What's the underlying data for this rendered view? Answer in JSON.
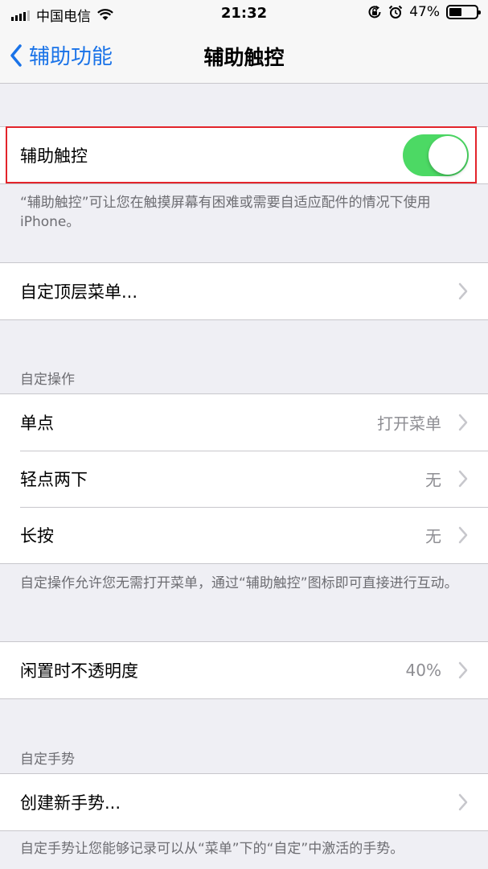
{
  "status_bar": {
    "carrier": "中国电信",
    "time": "21:32",
    "battery_percent": "47%",
    "battery_level": 0.47,
    "signal_bars_filled": 4,
    "icons": [
      "signal-icon",
      "wifi-icon",
      "orientation-lock-icon",
      "alarm-icon",
      "battery-icon"
    ]
  },
  "nav": {
    "back_label": "辅助功能",
    "title": "辅助触控",
    "accent_color": "#1a73e8"
  },
  "assistive_touch": {
    "label": "辅助触控",
    "enabled": true,
    "toggle_color": "#4cd964",
    "highlight_color": "#e3242b",
    "footer": "“辅助触控”可让您在触摸屏幕有困难或需要自适应配件的情况下使用 iPhone。"
  },
  "top_menu": {
    "label": "自定顶层菜单..."
  },
  "custom_actions": {
    "header": "自定操作",
    "rows": [
      {
        "label": "单点",
        "value": "打开菜单"
      },
      {
        "label": "轻点两下",
        "value": "无"
      },
      {
        "label": "长按",
        "value": "无"
      }
    ],
    "footer": "自定操作允许您无需打开菜单，通过“辅助触控”图标即可直接进行互动。"
  },
  "idle_opacity": {
    "label": "闲置时不透明度",
    "value": "40%"
  },
  "custom_gestures": {
    "header": "自定手势",
    "row_label": "创建新手势...",
    "footer": "自定手势让您能够记录可以从“菜单”下的“自定”中激活的手势。"
  }
}
